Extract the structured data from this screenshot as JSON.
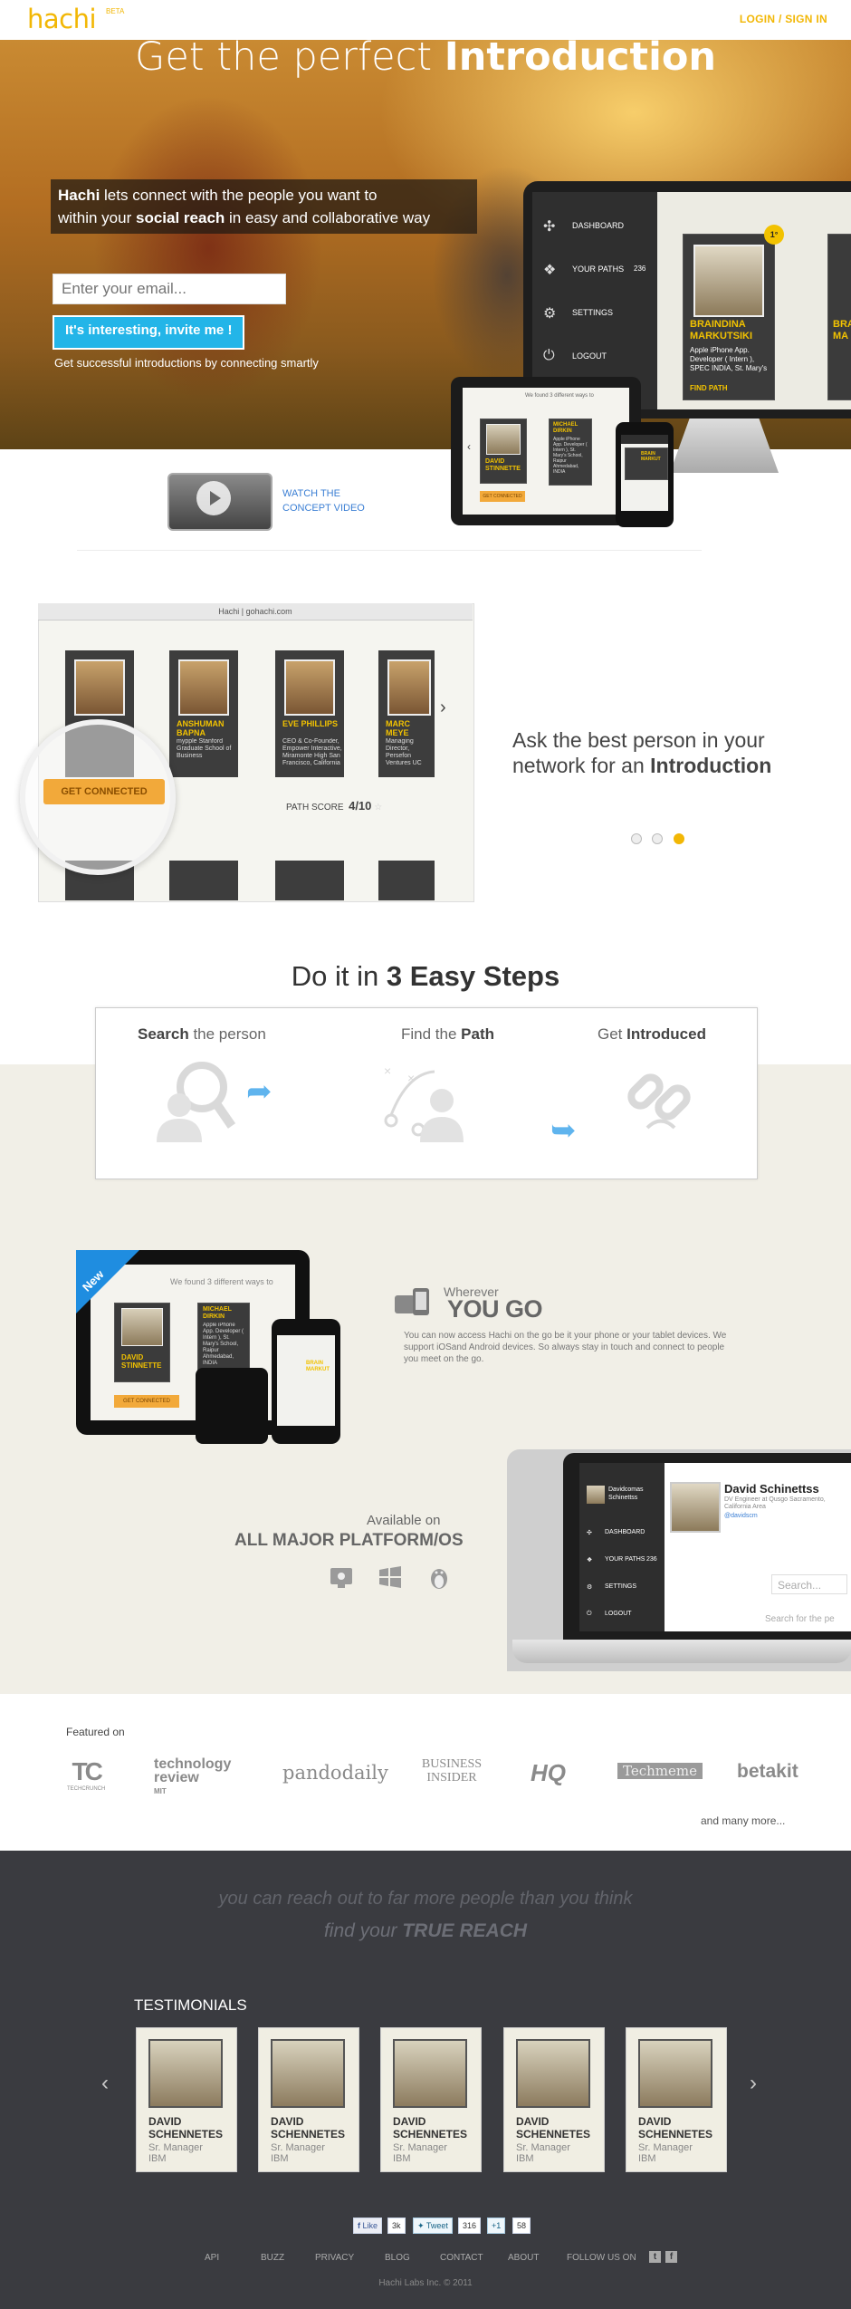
{
  "header": {
    "logo": "hachi",
    "beta": "BETA",
    "login": "LOGIN / SIGN IN"
  },
  "hero": {
    "title_light": "Get the perfect",
    "title_bold": "Introduction",
    "tagline_1_bold": "Hachi",
    "tagline_1_rest": "lets connect with the people you want to",
    "tagline_2_pre": "within your",
    "tagline_2_bold": "social reach",
    "tagline_2_post": "in easy and collaborative way",
    "email_placeholder": "Enter your email...",
    "invite_button": "It's interesting, invite me !",
    "subtext": "Get successful introductions by connecting smartly"
  },
  "desktop_mock": {
    "menu": [
      "DASHBOARD",
      "YOUR PATHS",
      "SETTINGS",
      "LOGOUT"
    ],
    "paths_count": "236",
    "badge": "1°",
    "card_name_1": "BRAINDINA",
    "card_name_2": "MARKUTSIKI",
    "card_desc": "Apple iPhone App. Developer ( Intern ), SPEC INDIA, St. Mary's",
    "find_path": "FIND PATH",
    "card2_prefix": "BRA",
    "card2_prefix2": "MA"
  },
  "tablet_mock": {
    "header": "We found 3 different ways to",
    "name_1": "DAVID",
    "name_2": "STINNETTE",
    "name_b1": "MICHAEL",
    "name_b2": "DIRKIN",
    "desc": "Apple iPhone App. Developer ( Intern ), St. Mary's School, Raipur Ahmedabad, INDIA",
    "get_connected": "GET CONNECTED"
  },
  "phone_mock": {
    "name_1": "BRAIN",
    "name_2": "MARKUT"
  },
  "video": {
    "link_1": "WATCH THE",
    "link_2": "CONCEPT VIDEO"
  },
  "slider": {
    "browser_title": "Hachi | gohachi.com",
    "cards": [
      {
        "name": "",
        "desc": ""
      },
      {
        "name": "ANSHUMAN BAPNA",
        "desc": "mypple Stanford Graduate School of Business"
      },
      {
        "name": "EVE PHILLIPS",
        "desc": "CEO & Co-Founder, Empower Interactive, Miramonte High San Francisco, California"
      },
      {
        "name": "MARC MEYE",
        "desc": "Managing Director, Persefon Ventures UC Berkeley San Francisco, California"
      }
    ],
    "get_connected": "GET CONNECTED",
    "path_score_label": "PATH SCORE",
    "path_score": "4/10",
    "ask_1": "Ask the best person in your",
    "ask_2_pre": "network for an",
    "ask_2_bold": "Introduction"
  },
  "steps": {
    "title_pre": "Do it in",
    "title_bold": "3 Easy Steps",
    "step1_bold": "Search",
    "step1_rest": "the person",
    "step2_pre": "Find the",
    "step2_bold": "Path",
    "step3_pre": "Get",
    "step3_bold": "Introduced"
  },
  "mobile": {
    "new_badge": "New",
    "wherever_small": "Wherever",
    "wherever_big": "YOU GO",
    "wherever_text": "You can now access Hachi on the go be it your phone or your tablet devices. We support iOSand Android devices. So always stay in touch and connect to people you meet on the go.",
    "available_small": "Available on",
    "available_big": "ALL MAJOR PLATFORM/OS",
    "os_icons": [
      "apple-mac-icon",
      "windows-icon",
      "linux-tux-icon"
    ]
  },
  "laptop_mock": {
    "user": "Davidcomas Schinettss",
    "menu": [
      "DASHBOARD",
      "YOUR PATHS",
      "SETTINGS",
      "LOGOUT"
    ],
    "paths_count": "236",
    "profile_name": "David Schinettss",
    "profile_desc": "DV Engineer at Qusgo Sacramento, California Area",
    "profile_handle": "@davidscm",
    "search_placeholder": "Search...",
    "search_hint": "Search for the pe"
  },
  "featured": {
    "label": "Featured on",
    "logos": [
      {
        "name": "TC",
        "sub": "TECHCRUNCH"
      },
      {
        "name": "technology review",
        "sub": "MIT"
      },
      {
        "name": "pandodaily",
        "sub": ""
      },
      {
        "name": "BUSINESS INSIDER",
        "sub": ""
      },
      {
        "name": "HQ",
        "sub": ""
      },
      {
        "name": "Techmeme",
        "sub": ""
      },
      {
        "name": "betakit",
        "sub": ""
      }
    ],
    "more": "and many more..."
  },
  "reach": {
    "line_1": "you can reach out to far more people than you think",
    "line_2_pre": "find your",
    "line_2_bold": "TRUE REACH"
  },
  "testimonials": {
    "title": "TESTIMONIALS",
    "cards": [
      {
        "name_1": "DAVID",
        "name_2": "SCHENNETES",
        "role": "Sr. Manager",
        "org": "IBM"
      },
      {
        "name_1": "DAVID",
        "name_2": "SCHENNETES",
        "role": "Sr. Manager",
        "org": "IBM"
      },
      {
        "name_1": "DAVID",
        "name_2": "SCHENNETES",
        "role": "Sr. Manager",
        "org": "IBM"
      },
      {
        "name_1": "DAVID",
        "name_2": "SCHENNETES",
        "role": "Sr. Manager",
        "org": "IBM"
      },
      {
        "name_1": "DAVID",
        "name_2": "SCHENNETES",
        "role": "Sr. Manager",
        "org": "IBM"
      }
    ]
  },
  "social": {
    "like": "Like",
    "like_count": "3k",
    "tweet": "Tweet",
    "tweet_count": "316",
    "plus": "+1",
    "plus_count": "58"
  },
  "footer": {
    "links": [
      "API",
      "BUZZ",
      "PRIVACY",
      "BLOG",
      "CONTACT",
      "ABOUT"
    ],
    "follow": "FOLLOW US ON",
    "copyright": "Hachi Labs Inc. © 2011"
  },
  "colors": {
    "brand": "#f2b705",
    "accent_blue": "#23b5e8",
    "dark_bg": "#3a3b40",
    "beige": "#f1efe7"
  }
}
